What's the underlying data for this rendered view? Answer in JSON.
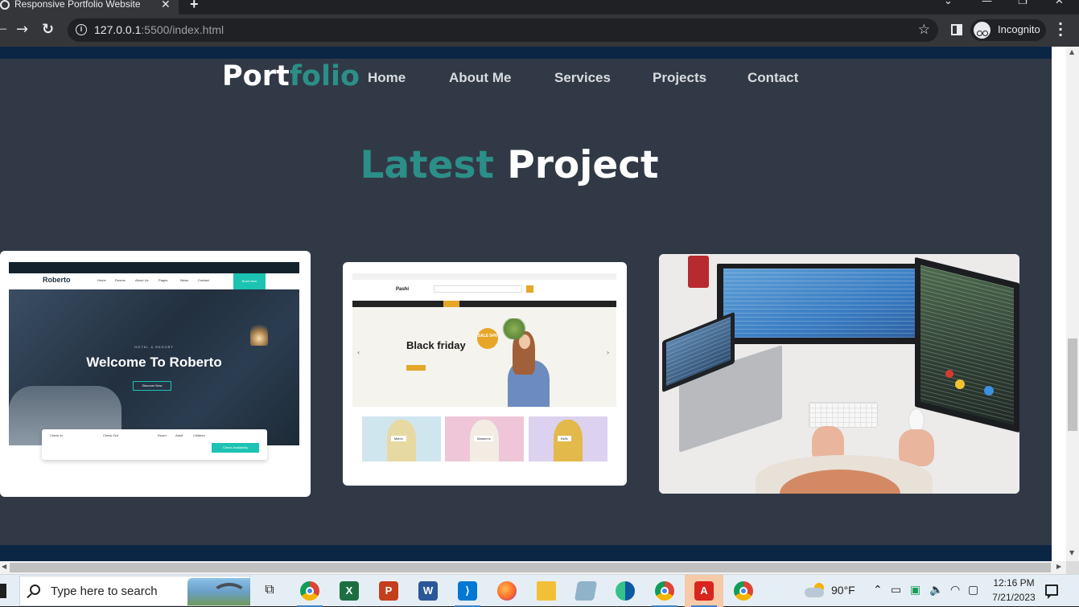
{
  "browser": {
    "tab_title": "Responsive Portfolio Website",
    "tab_close": "✕",
    "new_tab": "+",
    "url_host": "127.0.0.1",
    "url_rest": ":5500/index.html",
    "profile_label": "Incognito",
    "window_controls": [
      "⌄",
      "—",
      "❐",
      "✕"
    ]
  },
  "site": {
    "logo_main": "Port",
    "logo_accent": "folio",
    "nav": [
      "Home",
      "About Me",
      "Services",
      "Projects",
      "Contact"
    ],
    "section_title_accent": "Latest",
    "section_title_main": "Project",
    "accent_color": "#2b8f88",
    "background_color": "#323946",
    "band_color": "#0b2545"
  },
  "projects": [
    {
      "name": "Roberto",
      "kicker": "HOTEL & RESORT",
      "headline": "Welcome To Roberto",
      "cta": "Discover Now",
      "menu": [
        "Home",
        "Rooms",
        "About Us",
        "Pages",
        "News",
        "Contact"
      ],
      "book_label": "Book Now",
      "form_fields": [
        "Check In",
        "Check Out",
        "Room",
        "Adult",
        "Children"
      ],
      "form_button": "Check Availability"
    },
    {
      "name": "Pashi",
      "headline": "Black friday",
      "badge": "SALE 54%",
      "categories": [
        "Men's",
        "Women's",
        "Kid's"
      ]
    },
    {
      "name": "workspace-photo"
    }
  ],
  "taskbar": {
    "search_placeholder": "Type here to search",
    "apps": [
      "task-view",
      "chrome",
      "excel",
      "powerpoint",
      "word",
      "vscode",
      "firefox",
      "file-explorer",
      "notepad",
      "edge",
      "chrome-profile",
      "acrobat",
      "chrome-alt"
    ],
    "temperature": "90°F",
    "time": "12:16 PM",
    "date": "7/21/2023"
  }
}
